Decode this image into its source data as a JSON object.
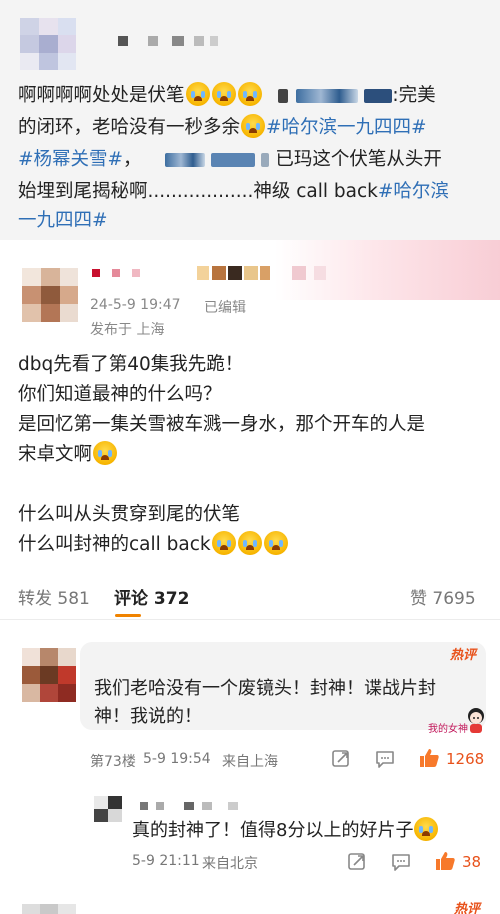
{
  "original_post": {
    "line1_text": "啊啊啊啊处处是伏笔",
    "line1_tail": ":完美",
    "line2_text": "的闭环，老哈没有一秒多余",
    "line2_tag": "#哈尔滨一九四四#",
    "line3_tag": "#杨幂关雪#",
    "line3_text": "，",
    "line3_tail": "已玛这个伏笔从头开",
    "line4_text": "始埋到尾揭秘啊..................神级 call back",
    "line4_tag": "#哈尔滨",
    "line5_tag": "一九四四#"
  },
  "post": {
    "date": "24-5-9 19:47",
    "edited": "已编辑",
    "location": "发布于 上海",
    "lines": [
      "dbq先看了第40集我先跪！",
      "你们知道最神的什么吗？",
      "是回忆第一集关雪被车溅一身水，那个开车的人是",
      "宋卓文啊",
      "什么叫从头贯穿到尾的伏笔",
      "什么叫封神的call back"
    ]
  },
  "tabs": {
    "repost_label": "转发",
    "repost_count": "581",
    "comment_label": "评论",
    "comment_count": "372",
    "like_label": "赞",
    "like_count": "7695"
  },
  "comments": {
    "hot_label": "热评",
    "c1_line1": "我们老哈没有一个废镜头！封神！谍战片封",
    "c1_line2": "神！我说的！",
    "c1_floor": "第73楼",
    "c1_time": "5-9 19:54",
    "c1_loc": "来自上海",
    "c1_likes": "1268",
    "sticker_text": "我的女神",
    "c2_text": "真的封神了！值得8分以上的好片子",
    "c2_time": "5-9 21:11",
    "c2_loc": "来自北京",
    "c2_likes": "38",
    "hot_label_2": "热评"
  },
  "colors": {
    "hashtag": "#2f6fb6",
    "accent": "#f08300",
    "hot": "#e8521b"
  },
  "icons": [
    "repost-icon",
    "comment-icon",
    "like-icon"
  ]
}
